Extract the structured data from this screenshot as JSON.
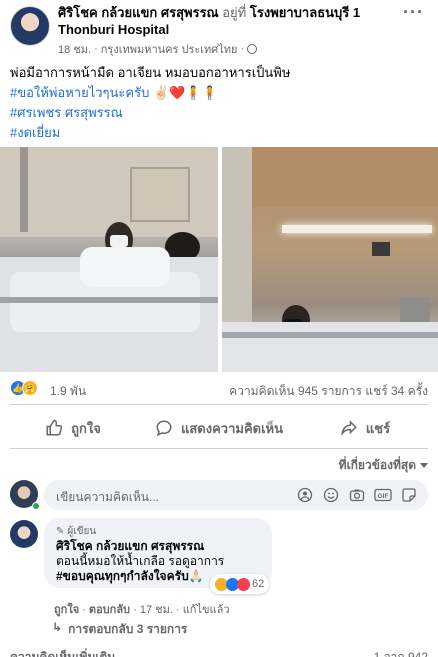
{
  "post": {
    "author": "ศิริโชค กล้วยแขก ศรสุพรรณ",
    "at_prefix": "อยู่ที่",
    "place": "โรงพยาบาลธนบุรี 1 Thonburi Hospital",
    "time": "18 ชม.",
    "location": "กรุงเทพมหานคร ประเทศไทย",
    "more_icon": "ellipsis-icon",
    "text_line1": "พ่อมีอาการหน้ามืด อาเจียน หมอบอกอาหารเป็นพิษ",
    "hashtag1": "#ขอให้พ่อหายไวๆนะครับ",
    "hashtag1_suffix": "✌🏻❤️🧍🧍",
    "hashtag2": "#ศรเพชร ศรสุพรรณ",
    "hashtag3": "#งดเยี่ยม"
  },
  "stats": {
    "reaction_count": "1.9 พัน",
    "comments": "ความคิดเห็น 945 รายการ",
    "shares": "แชร์ 34 ครั้ง"
  },
  "actions": {
    "like": "ถูกใจ",
    "comment": "แสดงความคิดเห็น",
    "share": "แชร์"
  },
  "sort_label": "ที่เกี่ยวข้องที่สุด",
  "compose": {
    "placeholder": "เขียนความคิดเห็น..."
  },
  "comment": {
    "badge": "ผู้เขียน",
    "author": "ศิริโชค กล้วยแขก ศรสุพรรณ",
    "line1": "ตอนนี้หมอให้น้ำเกลือ รอดูอาการ",
    "hashtag": "#ขอบคุณทุกๆกำลังใจครับ",
    "hashtag_suffix": "🙏🏻",
    "reaction_count": "62",
    "meta_like": "ถูกใจ",
    "meta_reply": "ตอบกลับ",
    "meta_time": "17 ชม.",
    "meta_edited": "แก้ไขแล้ว",
    "replies_label": "การตอบกลับ 3 รายการ"
  },
  "footer": {
    "more_comments": "ความคิดเห็นเพิ่มเติม",
    "count": "1 จาก 942"
  },
  "colors": {
    "link": "#216fdb",
    "muted": "#65676b",
    "like_blue": "#1877f2",
    "bubble": "#f0f2f5"
  }
}
